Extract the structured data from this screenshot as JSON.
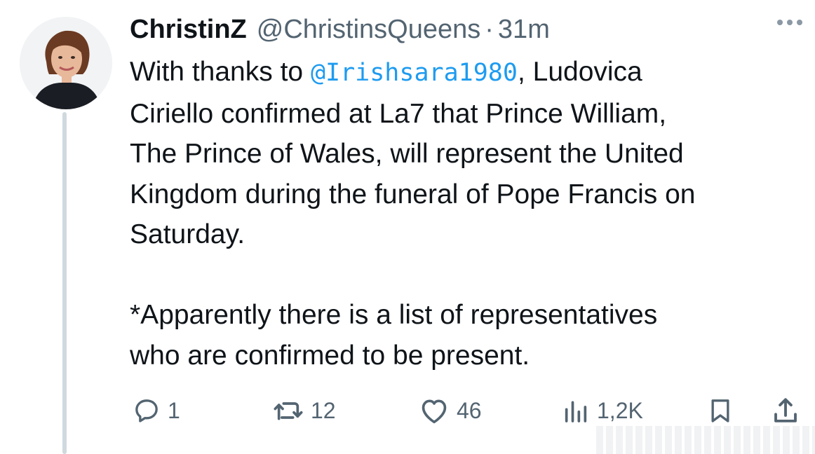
{
  "author": {
    "name": "ChristinZ",
    "handle": "@ChristinsQueens",
    "separator": "·",
    "time": "31m"
  },
  "tweet": {
    "lines": [
      {
        "before": "With thanks to ",
        "mention": "@Irishsara1980",
        "after": ", Ludovica"
      },
      {
        "text": "Ciriello confirmed at La7 that Prince William,"
      },
      {
        "text": "The Prince of Wales, will represent the United"
      },
      {
        "text": "Kingdom during the funeral of Pope Francis on"
      },
      {
        "text": "Saturday."
      },
      {
        "text": "*Apparently there is a list of representatives"
      },
      {
        "text": "who are confirmed to be present."
      }
    ]
  },
  "actions": {
    "replies": "1",
    "reposts": "12",
    "likes": "46",
    "views": "1,2K"
  },
  "icons": {
    "reply": "reply-icon",
    "repost": "repost-icon",
    "like": "heart-icon",
    "views": "views-icon",
    "bookmark": "bookmark-icon",
    "share": "share-icon",
    "more": "more-icon"
  },
  "colors": {
    "text": "#0f1419",
    "secondary": "#536471",
    "link": "#1d9bf0",
    "thread_line": "#cfd9de"
  }
}
